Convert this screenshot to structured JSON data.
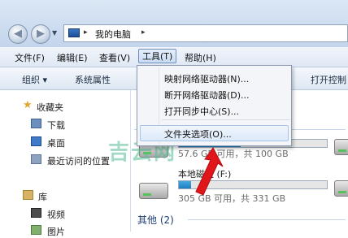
{
  "address": {
    "separator": "▸",
    "location": "我的电脑"
  },
  "menubar": {
    "items": [
      "文件(F)",
      "编辑(E)",
      "查看(V)",
      "工具(T)",
      "帮助(H)"
    ],
    "active_index": 3
  },
  "toolbar": {
    "organize": "组织 ▾",
    "system_properties": "系统属性",
    "open_control": "打开控制"
  },
  "sidebar": {
    "favorites": "收藏夹",
    "favorite_items": [
      "下载",
      "桌面",
      "最近访问的位置"
    ],
    "libraries": "库",
    "library_items": [
      "视频",
      "图片"
    ]
  },
  "tools_menu": {
    "items": [
      "映射网络驱动器(N)...",
      "断开网络驱动器(D)...",
      "打开同步中心(S)...",
      "文件夹选项(O)..."
    ],
    "highlighted_index": 3
  },
  "drives": [
    {
      "name": "",
      "free_text": "57.6 GB 可用，共 100 GB",
      "used_fraction": 0.42
    },
    {
      "name": "本地磁盘 (F:)",
      "free_text": "305 GB 可用，共 331 GB",
      "used_fraction": 0.08
    }
  ],
  "other_group": "其他 (2)",
  "watermark": "吉云网",
  "colors": {
    "bar_fill": "#1e7dc0",
    "arrow": "#e0161b"
  }
}
